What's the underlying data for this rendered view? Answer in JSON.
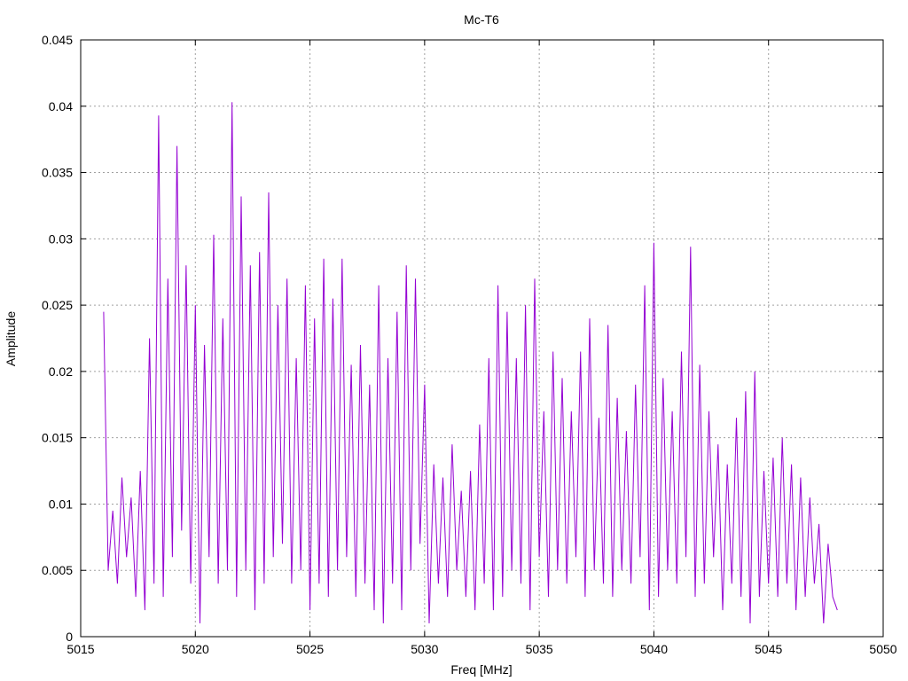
{
  "chart_data": {
    "type": "line",
    "title": "Mc-T6",
    "xlabel": "Freq [MHz]",
    "ylabel": "Amplitude",
    "xlim": [
      5015,
      5050
    ],
    "ylim": [
      0,
      0.045
    ],
    "grid": true,
    "x_ticks": [
      "5015",
      "5020",
      "5025",
      "5030",
      "5035",
      "5040",
      "5045",
      "5050"
    ],
    "y_ticks": [
      "0",
      "0.005",
      "0.01",
      "0.015",
      "0.02",
      "0.025",
      "0.03",
      "0.035",
      "0.04",
      "0.045"
    ],
    "x_tick_values": [
      5015,
      5020,
      5025,
      5030,
      5035,
      5040,
      5045,
      5050
    ],
    "y_tick_values": [
      0,
      0.005,
      0.01,
      0.015,
      0.02,
      0.025,
      0.03,
      0.035,
      0.04,
      0.045
    ],
    "series": [
      {
        "name": "Mc-T6",
        "color": "#9400d3",
        "x_start": 5016.0,
        "x_step": 0.2,
        "values": [
          0.0245,
          0.005,
          0.0095,
          0.004,
          0.012,
          0.006,
          0.0105,
          0.003,
          0.0125,
          0.002,
          0.0225,
          0.004,
          0.0393,
          0.003,
          0.027,
          0.006,
          0.037,
          0.008,
          0.028,
          0.004,
          0.025,
          0.001,
          0.022,
          0.006,
          0.0303,
          0.004,
          0.024,
          0.005,
          0.0403,
          0.003,
          0.0332,
          0.005,
          0.028,
          0.002,
          0.029,
          0.004,
          0.0335,
          0.006,
          0.025,
          0.007,
          0.027,
          0.004,
          0.021,
          0.005,
          0.0265,
          0.002,
          0.024,
          0.004,
          0.0285,
          0.003,
          0.0255,
          0.005,
          0.0285,
          0.006,
          0.0205,
          0.003,
          0.022,
          0.004,
          0.019,
          0.002,
          0.0265,
          0.001,
          0.021,
          0.004,
          0.0245,
          0.002,
          0.028,
          0.005,
          0.027,
          0.007,
          0.019,
          0.001,
          0.013,
          0.004,
          0.012,
          0.003,
          0.0145,
          0.005,
          0.011,
          0.003,
          0.0125,
          0.002,
          0.016,
          0.004,
          0.021,
          0.002,
          0.0265,
          0.003,
          0.0245,
          0.005,
          0.021,
          0.004,
          0.025,
          0.002,
          0.027,
          0.006,
          0.017,
          0.003,
          0.0215,
          0.005,
          0.0195,
          0.004,
          0.017,
          0.006,
          0.0215,
          0.003,
          0.024,
          0.005,
          0.0165,
          0.004,
          0.0235,
          0.003,
          0.018,
          0.005,
          0.0155,
          0.004,
          0.019,
          0.006,
          0.0265,
          0.002,
          0.0297,
          0.003,
          0.0195,
          0.005,
          0.017,
          0.004,
          0.0215,
          0.006,
          0.0294,
          0.003,
          0.0205,
          0.004,
          0.017,
          0.006,
          0.0145,
          0.002,
          0.013,
          0.004,
          0.0165,
          0.003,
          0.0185,
          0.001,
          0.02,
          0.003,
          0.0125,
          0.004,
          0.0135,
          0.003,
          0.015,
          0.004,
          0.013,
          0.002,
          0.012,
          0.003,
          0.0105,
          0.004,
          0.0085,
          0.001,
          0.007,
          0.003,
          0.002
        ]
      }
    ]
  }
}
